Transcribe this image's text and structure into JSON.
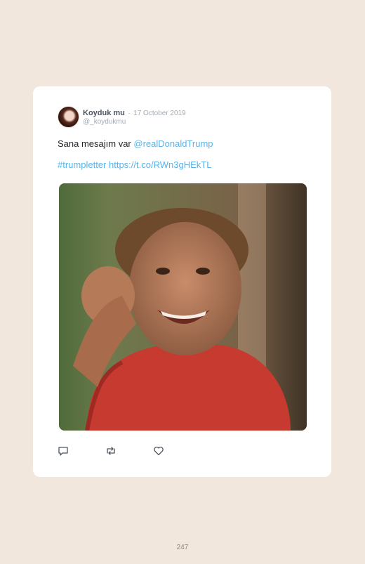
{
  "tweet": {
    "display_name": "Koyduk mu",
    "separator": "·",
    "date": "17 October 2019",
    "handle": "@_koydukmu",
    "text_prefix": "Sana mesajım var ",
    "mention": "@realDonaldTrump",
    "hashtag": "#trumpletter",
    "url": "https://t.co/RWn3gHEkTL",
    "image": "photo of smiling boy in red shirt",
    "actions": {
      "reply_icon": "reply-icon",
      "retweet_icon": "retweet-icon",
      "like_icon": "heart-icon"
    }
  },
  "page_number": "247",
  "colors": {
    "background": "#f2e7dd",
    "card": "#ffffff",
    "link": "#5ab3e8",
    "muted": "#a2abb5"
  }
}
